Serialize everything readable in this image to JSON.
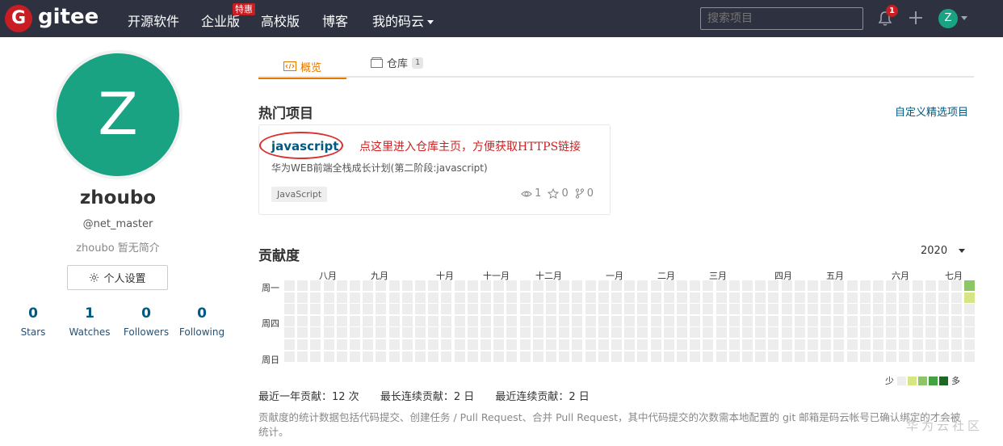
{
  "header": {
    "logo_letter": "G",
    "brand": "gitee",
    "nav": [
      "开源软件",
      "企业版",
      "高校版",
      "博客",
      "我的码云"
    ],
    "enterprise_badge": "特惠",
    "search_placeholder": "搜索项目",
    "notification_count": "1",
    "avatar_letter": "Z"
  },
  "profile": {
    "avatar_letter": "Z",
    "name": "zhoubo",
    "handle": "@net_master",
    "bio": "zhoubo 暂无简介",
    "settings_label": "个人设置",
    "stats": [
      {
        "value": "0",
        "label": "Stars"
      },
      {
        "value": "1",
        "label": "Watches"
      },
      {
        "value": "0",
        "label": "Followers"
      },
      {
        "value": "0",
        "label": "Following"
      }
    ]
  },
  "tabs": {
    "overview": "概览",
    "repos": "仓库",
    "repos_count": "1"
  },
  "popular": {
    "title": "热门项目",
    "custom_link": "自定义精选项目",
    "project": {
      "name": "javascript",
      "annotation": "点这里进入仓库主页，方便获取HTTPS链接",
      "description": "华为WEB前端全栈成长计划(第二阶段:javascript)",
      "language": "JavaScript",
      "watches": "1",
      "stars": "0",
      "forks": "0"
    }
  },
  "contribution": {
    "title": "贡献度",
    "year": "2020",
    "months": [
      "八月",
      "九月",
      "十月",
      "十一月",
      "十二月",
      "一月",
      "二月",
      "三月",
      "四月",
      "五月",
      "六月",
      "七月"
    ],
    "days": [
      "周一",
      "周四",
      "周日"
    ],
    "legend_low": "少",
    "legend_high": "多",
    "colors": {
      "empty": "#ededed",
      "level1": "#d6e685",
      "level2": "#8cc665",
      "level3": "#44a340",
      "level4": "#1e6823"
    },
    "active_cells": [
      {
        "col": 52,
        "row": 0,
        "level": 2
      },
      {
        "col": 52,
        "row": 1,
        "level": 1
      }
    ],
    "summary": {
      "total": "最近一年贡献：12 次",
      "longest": "最长连续贡献：2 日",
      "recent": "最近连续贡献：2 日"
    },
    "note": "贡献度的统计数据包括代码提交、创建任务 / Pull Request、合并 Pull Request，其中代码提交的次数需本地配置的 git 邮箱是码云帐号已确认绑定的才会被统计。"
  },
  "watermark": "华为云社区"
}
